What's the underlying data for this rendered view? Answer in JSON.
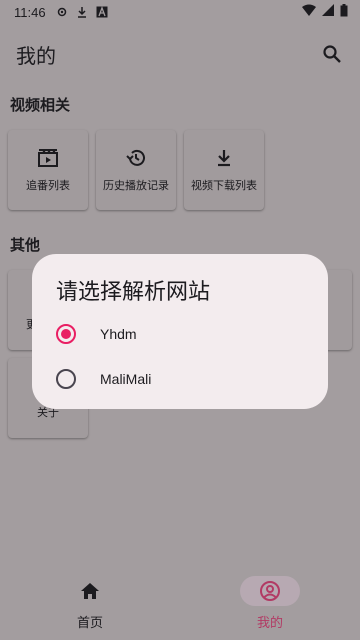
{
  "status_bar": {
    "time": "11:46"
  },
  "app_bar": {
    "title": "我的",
    "search_icon": "search-icon"
  },
  "sections": {
    "video": {
      "title": "视频相关",
      "items": [
        {
          "label": "追番列表",
          "icon": "movie-icon"
        },
        {
          "label": "历史播放记录",
          "icon": "history-icon"
        },
        {
          "label": "视频下载列表",
          "icon": "download-icon"
        }
      ]
    },
    "other": {
      "title": "其他",
      "items": [
        {
          "label": "更",
          "icon": ""
        },
        {
          "label": "关于",
          "icon": ""
        }
      ]
    }
  },
  "dialog": {
    "title": "请选择解析网站",
    "options": [
      {
        "label": "Yhdm",
        "selected": true
      },
      {
        "label": "MaliMali",
        "selected": false
      }
    ]
  },
  "bottom_nav": {
    "items": [
      {
        "label": "首页",
        "icon": "home-icon",
        "active": false
      },
      {
        "label": "我的",
        "icon": "account-icon",
        "active": true
      }
    ]
  },
  "colors": {
    "accent": "#e91e63",
    "nav_active": "#b23a64",
    "scrim": "#a39d9f",
    "dialog_bg": "#f3ecee"
  }
}
